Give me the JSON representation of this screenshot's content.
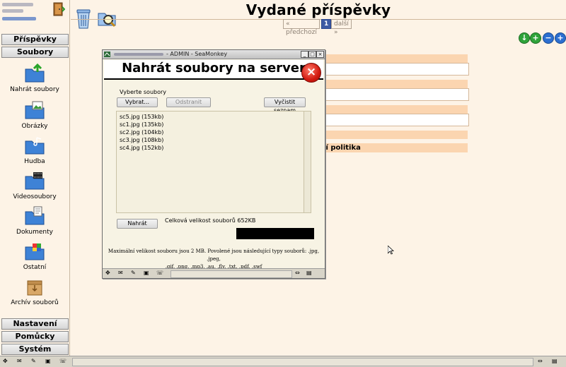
{
  "sidebar": {
    "sections": {
      "prispevky": "Příspěvky",
      "soubory": "Soubory",
      "nastaveni": "Nastavení",
      "pomucky": "Pomůcky",
      "system": "Systém"
    },
    "items": [
      {
        "label": "Nahrát soubory",
        "icon": "folder-upload-icon"
      },
      {
        "label": "Obrázky",
        "icon": "folder-images-icon"
      },
      {
        "label": "Hudba",
        "icon": "folder-music-icon"
      },
      {
        "label": "Videosoubory",
        "icon": "folder-video-icon"
      },
      {
        "label": "Dokumenty",
        "icon": "folder-documents-icon"
      },
      {
        "label": "Ostatní",
        "icon": "folder-other-icon"
      },
      {
        "label": "Archív souborů",
        "icon": "archive-box-icon"
      }
    ]
  },
  "header": {
    "title": "Vydané příspěvky",
    "pager": {
      "prev": "« předchozí",
      "current": "1",
      "next": "další »"
    }
  },
  "background": {
    "partial_text": "iční politika"
  },
  "popup": {
    "window_title": "- ADMIN - SeaMonkey",
    "heading": "Nahrát soubory na server",
    "select_label": "Vyberte soubory",
    "choose_button": "Vybrat...",
    "remove_button": "Odstranit",
    "clear_button": "Vyčistit seznam",
    "files": [
      "sc5.jpg (153kb)",
      "sc1.jpg (135kb)",
      "sc2.jpg (104kb)",
      "sc3.jpg (108kb)",
      "sc4.jpg (152kb)"
    ],
    "upload_button": "Nahrát",
    "total_size": "Celková velikost souborů 652KB",
    "limits_line1": "Maximální velikost souboru jsou 2 MB. Povolené jsou následující typy souborů: .jpg, .jpeg,",
    "limits_line2": ".gif, .png, .mp3, .au, .flv, .txt, .pdf, .swf"
  },
  "colors": {
    "page_bg": "#fdf3e6",
    "accent_bar": "#fbd5b0",
    "pager_current": "#3d5aa3",
    "green_button": "#2fa33a",
    "blue_button": "#2c6fd0"
  }
}
